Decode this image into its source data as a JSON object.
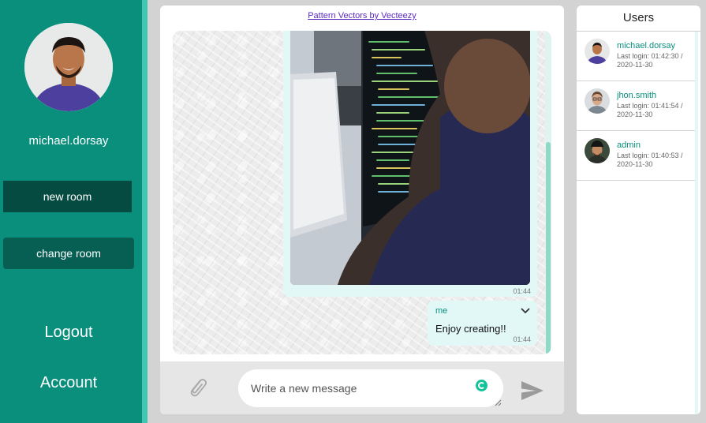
{
  "sidebar": {
    "username": "michael.dorsay",
    "new_room_label": "new room",
    "change_room_label": "change room",
    "logout_label": "Logout",
    "account_label": "Account"
  },
  "chat": {
    "credit_link": "Pattern Vectors by Vecteezy",
    "messages": [
      {
        "type": "image",
        "time": "01:44"
      },
      {
        "type": "text",
        "sender": "me",
        "text": "Enjoy creating!!",
        "time": "01:44"
      }
    ],
    "composer": {
      "placeholder": "Write a new message"
    }
  },
  "users": {
    "title": "Users",
    "list": [
      {
        "name": "michael.dorsay",
        "last_login": "Last login: 01:42:30 / 2020-11-30"
      },
      {
        "name": "jhon.smith",
        "last_login": "Last login: 01:41:54 / 2020-11-30"
      },
      {
        "name": "admin",
        "last_login": "Last login: 01:40:53 / 2020-11-30"
      }
    ]
  },
  "colors": {
    "brand": "#0b8f7d",
    "brand_dark": "#054b41",
    "bubble": "#e2f8f6",
    "link": "#5b2cc0"
  },
  "icons": [
    "paperclip-icon",
    "grammarly-icon",
    "send-icon",
    "chevron-down-icon"
  ]
}
